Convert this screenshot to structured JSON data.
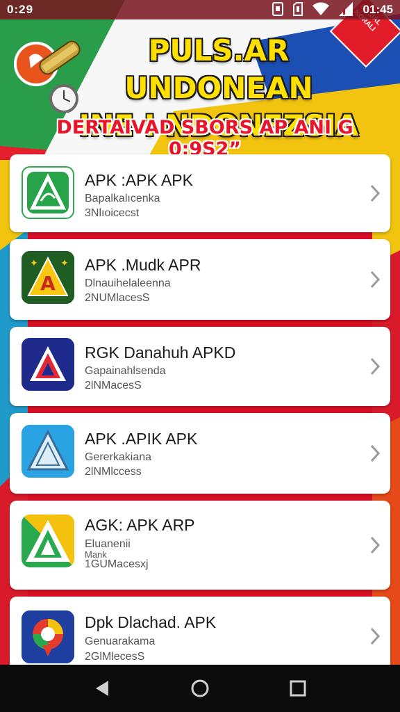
{
  "status_bar": {
    "time_left": "0:29",
    "time_right": "01:45",
    "icons": [
      "sim-icon",
      "sd-card-icon",
      "wifi-icon",
      "signal-icon"
    ]
  },
  "banner": {
    "title_line1": "PULS.AR UNDONEAN",
    "title_line2": "INE I NDONEZSIA",
    "subtitle": "DERTAIVAD SBORS AP ANI G 0:9S2”",
    "badge_text": "SOCIAL KORALI"
  },
  "apps": [
    {
      "title": "APK :APK APK",
      "sub1": "Bapalkalıcenka",
      "sub2": "3Nlıoicecst",
      "sub3": "",
      "icon": "green-apk-icon"
    },
    {
      "title": "APK .Mudk APR",
      "sub1": "Dlnauihelaleenna",
      "sub2": "2NUMlacesS",
      "sub3": "",
      "icon": "yellow-apk-icon"
    },
    {
      "title": "RGK Danahuh APKD",
      "sub1": "Gapainahlsenda",
      "sub2": "2lNMacesS",
      "sub3": "",
      "icon": "navy-apk-icon"
    },
    {
      "title": "APK .APIK APK",
      "sub1": "Gererkakiana",
      "sub2": "2lNMlccess",
      "sub3": "",
      "icon": "blue-apk-icon"
    },
    {
      "title": "AGK: APK ARP",
      "sub1": "Eluanenii",
      "sub2": "Mank",
      "sub3": "1GUMacesxj",
      "icon": "multicolor-apk-icon"
    },
    {
      "title": "Dpk Dlachad. APK",
      "sub1": "Genuarakama",
      "sub2": "2GlMlecesS",
      "sub3": "",
      "icon": "map-pin-apk-icon"
    }
  ],
  "colors": {
    "accent_red": "#e31c2a",
    "banner_yellow": "#ffe000",
    "card_bg": "#ffffff"
  },
  "nav": [
    "back-icon",
    "home-icon",
    "recents-icon"
  ]
}
